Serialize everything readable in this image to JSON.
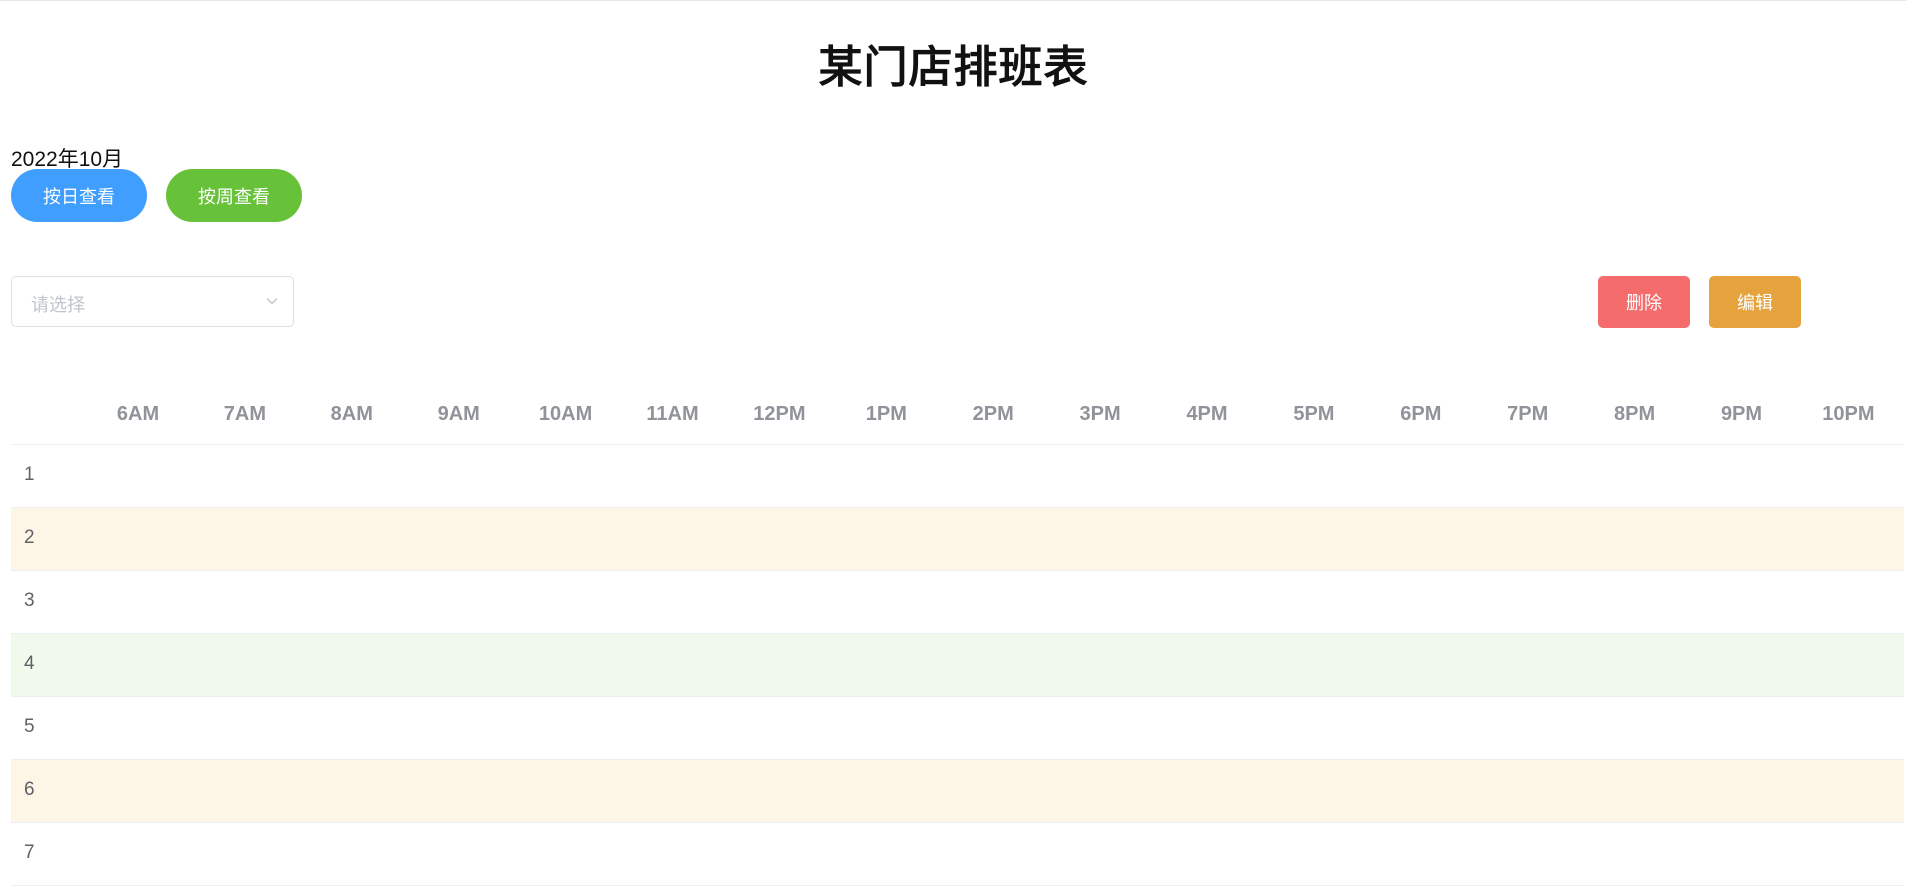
{
  "page": {
    "title": "某门店排班表",
    "month": "2022年10月"
  },
  "view_buttons": {
    "by_day": "按日查看",
    "by_week": "按周查看"
  },
  "select": {
    "placeholder": "请选择"
  },
  "actions": {
    "delete": "删除",
    "edit": "编辑"
  },
  "schedule": {
    "hours": [
      "6AM",
      "7AM",
      "8AM",
      "9AM",
      "10AM",
      "11AM",
      "12PM",
      "1PM",
      "2PM",
      "3PM",
      "4PM",
      "5PM",
      "6PM",
      "7PM",
      "8PM",
      "9PM",
      "10PM"
    ],
    "rows": [
      {
        "label": "1",
        "status": "none"
      },
      {
        "label": "2",
        "status": "warning"
      },
      {
        "label": "3",
        "status": "none"
      },
      {
        "label": "4",
        "status": "success"
      },
      {
        "label": "5",
        "status": "none"
      },
      {
        "label": "6",
        "status": "warning"
      },
      {
        "label": "7",
        "status": "none"
      }
    ]
  },
  "colors": {
    "primary": "#409eff",
    "success": "#67c23a",
    "danger": "#f56c6c",
    "warning": "#e6a23c",
    "row_warning": "#fdf5e6",
    "row_success": "#f0f9eb"
  },
  "icons": {
    "select_arrow": "chevron-down-icon"
  }
}
